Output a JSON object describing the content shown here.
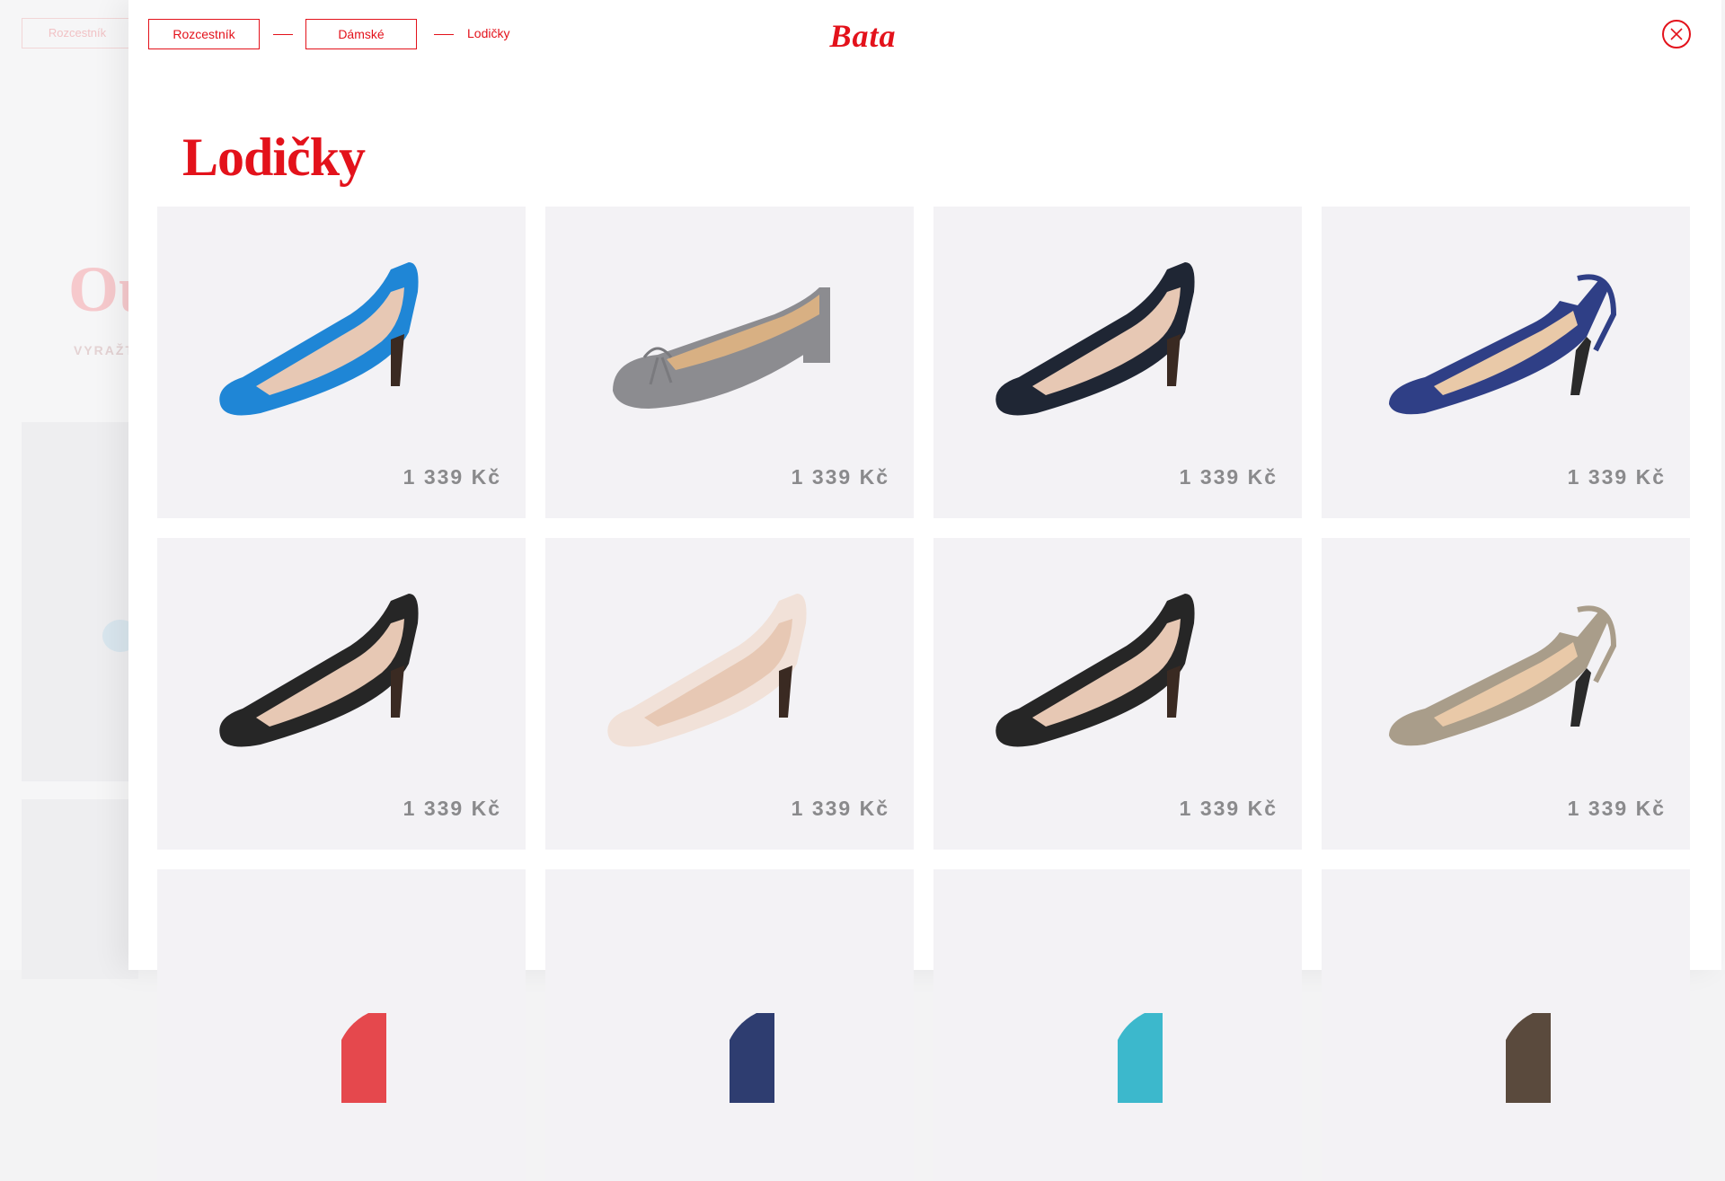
{
  "background_page": {
    "breadcrumb": "Rozcestník",
    "title_fragment": "Ou",
    "subtitle_fragment": "VYRAŽT"
  },
  "breadcrumb": {
    "items": [
      {
        "label": "Rozcestník"
      },
      {
        "label": "Dámské"
      }
    ],
    "current": "Lodičky"
  },
  "brand": {
    "logo_text": "Bata",
    "color": "#e3121b"
  },
  "page": {
    "title": "Lodičky"
  },
  "products": [
    {
      "price": "1 339 Kč",
      "color": "#1f86d6",
      "style": "pump"
    },
    {
      "price": "1 339 Kč",
      "color": "#8c8c90",
      "style": "flat"
    },
    {
      "price": "1 339 Kč",
      "color": "#1f2634",
      "style": "pump"
    },
    {
      "price": "1 339 Kč",
      "color": "#2f3f86",
      "style": "slingback"
    },
    {
      "price": "1 339 Kč",
      "color": "#262626",
      "style": "pump"
    },
    {
      "price": "1 339 Kč",
      "color": "#f1e1d8",
      "style": "pump"
    },
    {
      "price": "1 339 Kč",
      "color": "#262626",
      "style": "pump"
    },
    {
      "price": "1 339 Kč",
      "color": "#a99d8a",
      "style": "slingback"
    },
    {
      "price": "",
      "color": "#e5484d",
      "style": "partial"
    },
    {
      "price": "",
      "color": "#2e3d70",
      "style": "partial"
    },
    {
      "price": "",
      "color": "#3cb8cc",
      "style": "partial"
    },
    {
      "price": "",
      "color": "#5a4a3d",
      "style": "partial"
    }
  ]
}
